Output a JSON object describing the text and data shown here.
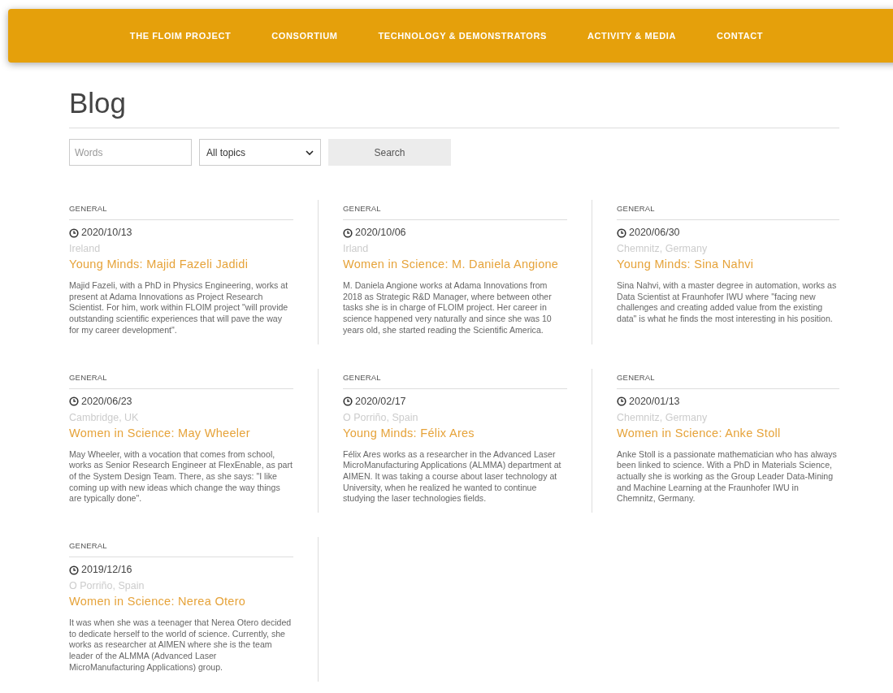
{
  "nav": {
    "items": [
      "THE FLOIM PROJECT",
      "CONSORTIUM",
      "TECHNOLOGY & DEMONSTRATORS",
      "ACTIVITY & MEDIA",
      "CONTACT"
    ]
  },
  "page_title": "Blog",
  "filters": {
    "words_placeholder": "Words",
    "topic": "All topics",
    "search_button": "Search"
  },
  "posts": [
    {
      "category": "GENERAL",
      "date": "2020/10/13",
      "location": "Ireland",
      "title": "Young Minds: Majid Fazeli Jadidi",
      "excerpt": "Majid Fazeli, with a PhD in Physics Engineering, works at present at Adama Innovations as Project Research Scientist. For him, work within FLOIM project \"will provide outstanding scientific experiences that will pave the way for my career development\"."
    },
    {
      "category": "GENERAL",
      "date": "2020/10/06",
      "location": "Irland",
      "title": "Women in Science: M. Daniela Angione",
      "excerpt": "M. Daniela Angione works at Adama Innovations from 2018 as Strategic R&D Manager, where between other tasks she is in charge of FLOIM project. Her career in science happened very naturally and since she was 10 years old, she started reading the Scientific America."
    },
    {
      "category": "GENERAL",
      "date": "2020/06/30",
      "location": "Chemnitz, Germany",
      "title": "Young Minds: Sina Nahvi",
      "excerpt": "Sina Nahvi, with a master degree in automation, works as Data Scientist at Fraunhofer IWU where \"facing new challenges and creating added value from the existing data\" is what he finds the most interesting in his position."
    },
    {
      "category": "GENERAL",
      "date": "2020/06/23",
      "location": "Cambridge, UK",
      "title": "Women in Science: May Wheeler",
      "excerpt": "May Wheeler, with a vocation that comes from school, works as Senior Research Engineer at FlexEnable, as part of the System Design Team. There, as she says: \"I like coming up with new ideas which change the way things are typically done\"."
    },
    {
      "category": "GENERAL",
      "date": "2020/02/17",
      "location": "O Porriño, Spain",
      "title": "Young Minds: Félix Ares",
      "excerpt": "Félix Ares works as a researcher in the Advanced Laser MicroManufacturing Applications (ALMMA) department at AIMEN. It was taking a course about laser technology at University, when he realized he wanted to continue studying the laser technologies fields."
    },
    {
      "category": "GENERAL",
      "date": "2020/01/13",
      "location": "Chemnitz, Germany",
      "title": "Women in Science: Anke Stoll",
      "excerpt": "Anke Stoll is a passionate mathematician who has always been linked to science. With a PhD in Materials Science, actually she is working as the Group Leader Data-Mining and Machine Learning at the Fraunhofer IWU in Chemnitz, Germany."
    },
    {
      "category": "GENERAL",
      "date": "2019/12/16",
      "location": "O Porriño, Spain",
      "title": "Women in Science: Nerea Otero",
      "excerpt": "It was when she was a teenager that Nerea Otero decided to dedicate herself to the world of science. Currently, she works as researcher at AIMEN where she is the team leader of the ALMMA (Advanced Laser MicroManufacturing Applications) group."
    }
  ]
}
